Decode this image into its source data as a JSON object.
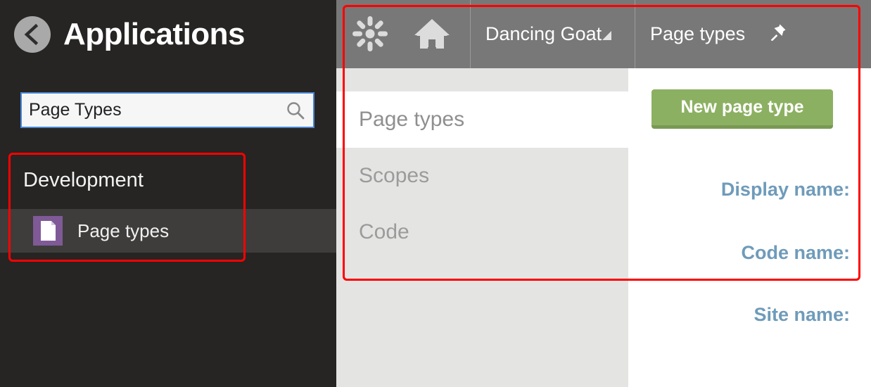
{
  "applications_panel": {
    "back_button": {
      "icon": "chevron-left-icon",
      "label": "Back"
    },
    "title": "Applications",
    "search": {
      "value": "Page Types",
      "placeholder": "Search",
      "icon": "search-icon"
    },
    "groups": [
      {
        "label": "Development",
        "items": [
          {
            "label": "Page types",
            "icon": "page-document-icon",
            "selected": true
          }
        ]
      }
    ]
  },
  "top_nav": {
    "logo_icon": "kentico-asterisk-logo-icon",
    "home_icon": "home-icon",
    "site_tab": {
      "label": "Dancing Goat",
      "caret_icon": "dropdown-caret-icon"
    },
    "app_tab": {
      "label": "Page types",
      "pin_icon": "pin-icon"
    }
  },
  "app_menu": {
    "items": [
      {
        "label": "Page types",
        "selected": true
      },
      {
        "label": "Scopes",
        "selected": false
      },
      {
        "label": "Code",
        "selected": false
      }
    ]
  },
  "content": {
    "new_button_label": "New page type",
    "fields": [
      {
        "label": "Display name:"
      },
      {
        "label": "Code name:"
      },
      {
        "label": "Site name:"
      }
    ]
  },
  "annotations": {
    "color": "#ff0000",
    "boxes": [
      {
        "name": "sidebar-development-highlight"
      },
      {
        "name": "application-area-highlight"
      }
    ]
  },
  "colors": {
    "panel_background": "#262523",
    "panel_selected_row": "#3e3d3b",
    "nav_background": "#787878",
    "menu_background": "#e4e5e3",
    "accent_green": "#8cb062",
    "accent_green_dark": "#7a9954",
    "label_blue": "#6f9bba",
    "icon_purple": "#7f5a97",
    "search_border": "#4a86d6",
    "annotation_red": "#ff0000"
  }
}
